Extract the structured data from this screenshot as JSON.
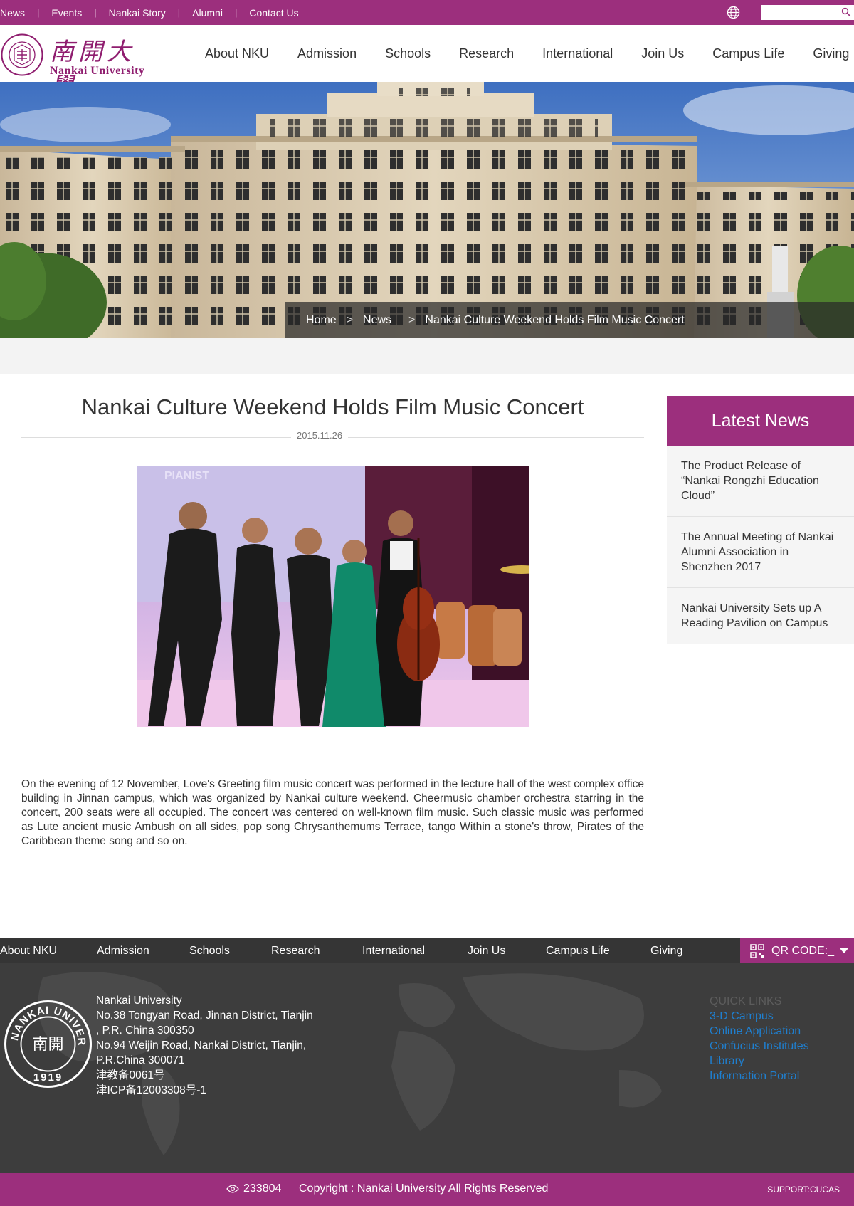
{
  "top_links": [
    "News",
    "Events",
    "Nankai Story",
    "Alumni",
    "Contact Us"
  ],
  "top_separator": "|",
  "search": {
    "value": "",
    "placeholder": ""
  },
  "logo": {
    "chinese": "南開大學",
    "english": "Nankai University",
    "seal_text": "NANKAI UNIVERSITY",
    "seal_center": "南開",
    "seal_year": "1919"
  },
  "main_nav": [
    "About NKU",
    "Admission",
    "Schools",
    "Research",
    "International",
    "Join Us",
    "Campus Life",
    "Giving"
  ],
  "breadcrumb": {
    "home": "Home",
    "section": "News",
    "current": "Nankai Culture Weekend Holds Film Music Concert",
    "separator": ">"
  },
  "article": {
    "title": "Nankai Culture Weekend Holds Film Music Concert",
    "date": "2015.11.26",
    "body": "On the evening of 12 November, Love's Greeting film music concert was performed in the lecture hall of the west complex office building in Jinnan campus, which was organized by Nankai culture weekend. Cheermusic chamber orchestra starring in the concert, 200 seats were all occupied. The concert was centered on well-known film music. Such classic music was performed as Lute ancient music Ambush on all sides, pop song Chrysanthemums Terrace, tango Within a stone's throw, Pirates of the Caribbean theme song and so on.",
    "photo_sign": "PIANIST"
  },
  "sidebar": {
    "title": "Latest News",
    "items": [
      "The Product Release of “Nankai Rongzhi Education Cloud”",
      "The Annual Meeting of Nankai Alumni Association in Shenzhen 2017",
      "Nankai University Sets up A Reading Pavilion on Campus"
    ]
  },
  "footer_nav": [
    "About NKU",
    "Admission",
    "Schools",
    "Research",
    "International",
    "Join Us",
    "Campus Life",
    "Giving"
  ],
  "qr_label": "QR CODE:_",
  "address_lines": [
    "Nankai University",
    "No.38 Tongyan Road, Jinnan District, Tianjin",
    ", P.R. China 300350",
    "No.94 Weijin Road,  Nankai District, Tianjin,",
    "P.R.China  300071",
    "津教备0061号",
    "津ICP备12003308号-1"
  ],
  "quick_links": {
    "title": "QUICK LINKS",
    "items": [
      "3-D Campus",
      "Online Application",
      "Confucius Institutes",
      "Library",
      "Information Portal"
    ]
  },
  "visit_count": "233804",
  "copyright": "Copyright : Nankai University All Rights Reserved",
  "support": "SUPPORT:CUCAS",
  "colors": {
    "brand": "#9c2f7d",
    "footer_dark": "#3d3d3d",
    "link_blue": "#1f7fcf"
  },
  "icons": [
    "globe-icon",
    "search-icon",
    "qr-code-icon",
    "chevron-down-icon",
    "eye-icon"
  ]
}
